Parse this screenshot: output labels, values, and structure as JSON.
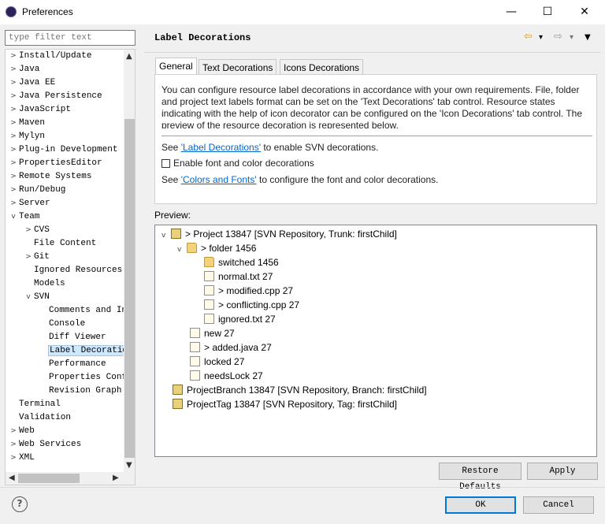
{
  "window": {
    "title": "Preferences",
    "minimize": "—",
    "maximize": "☐",
    "close": "✕"
  },
  "filter": {
    "placeholder": "type filter text"
  },
  "tree": [
    {
      "label": "Install/Update",
      "depth": 0,
      "twisty": ">"
    },
    {
      "label": "Java",
      "depth": 0,
      "twisty": ">"
    },
    {
      "label": "Java EE",
      "depth": 0,
      "twisty": ">"
    },
    {
      "label": "Java Persistence",
      "depth": 0,
      "twisty": ">"
    },
    {
      "label": "JavaScript",
      "depth": 0,
      "twisty": ">"
    },
    {
      "label": "Maven",
      "depth": 0,
      "twisty": ">"
    },
    {
      "label": "Mylyn",
      "depth": 0,
      "twisty": ">"
    },
    {
      "label": "Plug-in Development",
      "depth": 0,
      "twisty": ">"
    },
    {
      "label": "PropertiesEditor",
      "depth": 0,
      "twisty": ">"
    },
    {
      "label": "Remote Systems",
      "depth": 0,
      "twisty": ">"
    },
    {
      "label": "Run/Debug",
      "depth": 0,
      "twisty": ">"
    },
    {
      "label": "Server",
      "depth": 0,
      "twisty": ">"
    },
    {
      "label": "Team",
      "depth": 0,
      "twisty": "v"
    },
    {
      "label": "CVS",
      "depth": 1,
      "twisty": ">"
    },
    {
      "label": "File Content",
      "depth": 1,
      "twisty": ""
    },
    {
      "label": "Git",
      "depth": 1,
      "twisty": ">"
    },
    {
      "label": "Ignored Resources",
      "depth": 1,
      "twisty": ""
    },
    {
      "label": "Models",
      "depth": 1,
      "twisty": ""
    },
    {
      "label": "SVN",
      "depth": 1,
      "twisty": "v"
    },
    {
      "label": "Comments and In",
      "depth": 2,
      "twisty": ""
    },
    {
      "label": "Console",
      "depth": 2,
      "twisty": ""
    },
    {
      "label": "Diff Viewer",
      "depth": 2,
      "twisty": ""
    },
    {
      "label": "Label Decoratio",
      "depth": 2,
      "twisty": "",
      "selected": true
    },
    {
      "label": "Performance",
      "depth": 2,
      "twisty": ""
    },
    {
      "label": "Properties Conf",
      "depth": 2,
      "twisty": ""
    },
    {
      "label": "Revision Graph",
      "depth": 2,
      "twisty": ""
    },
    {
      "label": "Terminal",
      "depth": 0,
      "twisty": ""
    },
    {
      "label": "Validation",
      "depth": 0,
      "twisty": ""
    },
    {
      "label": "Web",
      "depth": 0,
      "twisty": ">"
    },
    {
      "label": "Web Services",
      "depth": 0,
      "twisty": ">"
    },
    {
      "label": "XML",
      "depth": 0,
      "twisty": ">"
    }
  ],
  "page": {
    "title": "Label Decorations",
    "nav_back": "⇦",
    "nav_forward": "⇨",
    "nav_dropdown": "▾",
    "menu": "▼"
  },
  "tabs": [
    "General",
    "Text Decorations",
    "Icons Decorations"
  ],
  "general": {
    "description": "You can configure resource label decorations in accordance with your own requirements. File, folder and project text labels format can be set on the 'Text Decorations' tab control. Resource states indicating with the help of icon decorator can be configured on the 'Icon Decorations' tab control. The preview of the resource decoration is represented below.",
    "see1_prefix": "See ",
    "see1_link": "'Label Decorations'",
    "see1_suffix": " to enable SVN decorations.",
    "checkbox_label": "Enable font and color decorations",
    "see2_prefix": "See ",
    "see2_link": "'Colors and Fonts'",
    "see2_suffix": " to configure the font and color decorations."
  },
  "preview": {
    "label": "Preview:",
    "nodes": [
      {
        "text": "> Project 13847 [SVN Repository, Trunk: firstChild]",
        "icon": "project-icon",
        "twisty": "v"
      },
      {
        "text": "> folder 1456",
        "icon": "folder-icon",
        "twisty": "v"
      },
      {
        "text": "switched 1456",
        "icon": "folder-icon",
        "twisty": ""
      },
      {
        "text": "normal.txt 27",
        "icon": "file-icon",
        "twisty": ""
      },
      {
        "text": "> modified.cpp 27",
        "icon": "file-icon",
        "twisty": ""
      },
      {
        "text": "> conflicting.cpp 27",
        "icon": "file-icon",
        "twisty": ""
      },
      {
        "text": "ignored.txt 27",
        "icon": "file-icon",
        "twisty": ""
      },
      {
        "text": "new 27",
        "icon": "file-icon",
        "twisty": ""
      },
      {
        "text": "> added.java 27",
        "icon": "file-icon",
        "twisty": ""
      },
      {
        "text": "locked 27",
        "icon": "file-icon",
        "twisty": ""
      },
      {
        "text": "needsLock 27",
        "icon": "file-icon",
        "twisty": ""
      },
      {
        "text": "ProjectBranch 13847 [SVN Repository, Branch: firstChild]",
        "icon": "project-icon",
        "twisty": ""
      },
      {
        "text": "ProjectTag 13847 [SVN Repository, Tag: firstChild]",
        "icon": "project-icon",
        "twisty": ""
      }
    ]
  },
  "buttons": {
    "restore_defaults": "Restore Defaults",
    "apply": "Apply",
    "ok": "OK",
    "cancel": "Cancel",
    "help": "?"
  },
  "colors": {
    "accent": "#0078d7",
    "link": "#0066cc",
    "selection": "#cde8ff"
  }
}
